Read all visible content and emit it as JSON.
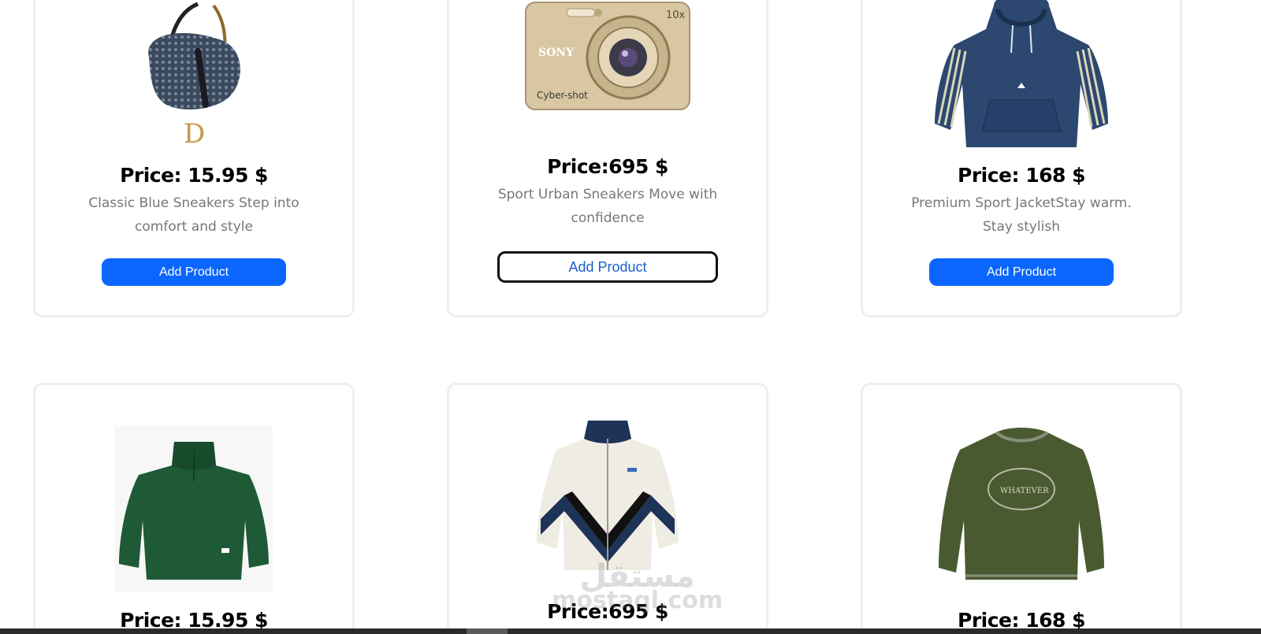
{
  "products": [
    {
      "price": "Price: 15.95 $",
      "description": "Classic Blue Sneakers Step into comfort and style",
      "button": "Add Product",
      "image": "saddle-bag-icon"
    },
    {
      "price": "Price:695 $",
      "description": "Sport Urban Sneakers Move with confidence",
      "button": "Add Product",
      "image": "camera-icon"
    },
    {
      "price": "Price: 168 $",
      "description": "Premium Sport JacketStay warm. Stay stylish",
      "button": "Add Product",
      "image": "hoodie-icon"
    },
    {
      "price": "Price: 15.95 $",
      "image": "green-sweater-icon"
    },
    {
      "price": "Price:695 $",
      "image": "fleece-jacket-icon"
    },
    {
      "price": "Price: 168 $",
      "image": "olive-sweatshirt-icon"
    }
  ],
  "watermark": {
    "arabic": "مستقل",
    "latin": "mostaql.com"
  }
}
